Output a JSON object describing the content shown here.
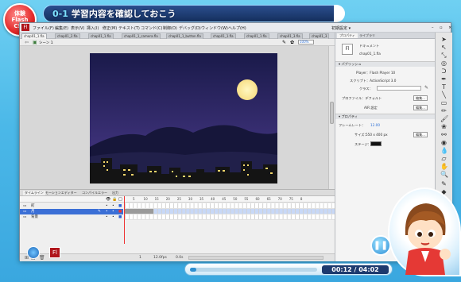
{
  "lesson": {
    "badge_lines": [
      "体験",
      "Flash",
      "CS4"
    ],
    "number": "0-1",
    "title": "学習内容を確認しておこう"
  },
  "app": {
    "logo": "Fl",
    "menu": [
      "ファイル(F)",
      "編集(E)",
      "表示(V)",
      "挿入(I)",
      "修正(M)",
      "テキスト(T)",
      "コマンド(C)",
      "制御(O)",
      "デバッグ(D)",
      "ウィンドウ(W)",
      "ヘルプ(H)"
    ],
    "workspace": "初期設定 ▾",
    "doc_tabs": [
      "chap01_1.fla",
      "chap01_2.fla",
      "chap01_1.fla",
      "chap01_1_camera.fla",
      "chap01_1_button.fla",
      "chap01_1.fla",
      "chap01_1.fla",
      "chap01_3.fla",
      "chap01_3"
    ],
    "scene_label": "シーン 1",
    "zoom": "100%"
  },
  "stage": {
    "sky_top": "#1a1a4a",
    "sky_bottom": "#4a3a8a",
    "moon_color": "#f8e08a",
    "ground_color": "#141414"
  },
  "timeline": {
    "tabs": [
      "タイムライン",
      "モーションエディター",
      "コンパイルエラー",
      "出力"
    ],
    "frame_numbers": [
      "5",
      "10",
      "15",
      "20",
      "25",
      "30",
      "35",
      "40",
      "45",
      "50",
      "55",
      "60",
      "65",
      "70",
      "75",
      "8"
    ],
    "layers": [
      {
        "name": "町",
        "selected": false
      },
      {
        "name": "月",
        "selected": true
      },
      {
        "name": "背景",
        "selected": false
      }
    ],
    "footer_fps": "12.0fps",
    "footer_time": "0.0s",
    "footer_frame": "1"
  },
  "properties": {
    "tabs": [
      "プロパティ",
      "ライブラリ"
    ],
    "doc_type": "ドキュメント",
    "doc_name": "chap01_1.fla",
    "publish_section": "パブリッシュ",
    "player_label": "Player：Flash Player 10",
    "script_label": "スクリプト：ActionScript 3.0",
    "class_label": "クラス：",
    "profile_label": "プロファイル：デフォルト",
    "air_label": "AIR 設定",
    "edit_btn": "編集...",
    "props_section": "プロパティ",
    "fps_label": "フレームレート：",
    "fps_value": "12.00",
    "size_label": "サイズ：",
    "size_value": "550 x 400 px",
    "stage_label": "ステージ："
  },
  "player": {
    "time": "00:12 / 04:02",
    "progress": 0.05
  }
}
